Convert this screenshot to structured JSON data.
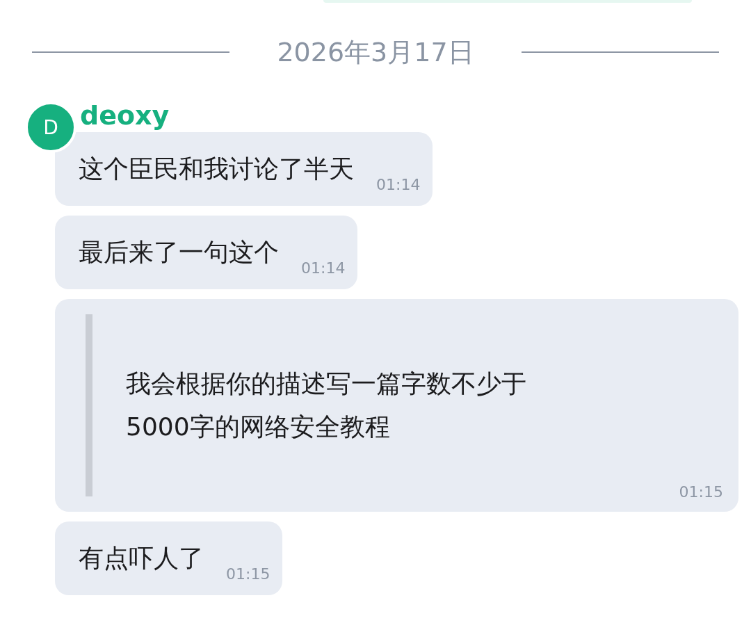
{
  "date_divider": "2026年3月17日",
  "sender": {
    "name": "deoxy",
    "initial": "D",
    "color": "#16b07f"
  },
  "messages": [
    {
      "kind": "text",
      "text": "这个臣民和我讨论了半天",
      "time": "01:14"
    },
    {
      "kind": "text",
      "text": "最后来了一句这个",
      "time": "01:14"
    },
    {
      "kind": "quote",
      "text": "我会根据你的描述写一篇字数不少于\n5000字的网络安全教程",
      "time": "01:15"
    },
    {
      "kind": "text",
      "text": "有点吓人了",
      "time": "01:15"
    }
  ]
}
